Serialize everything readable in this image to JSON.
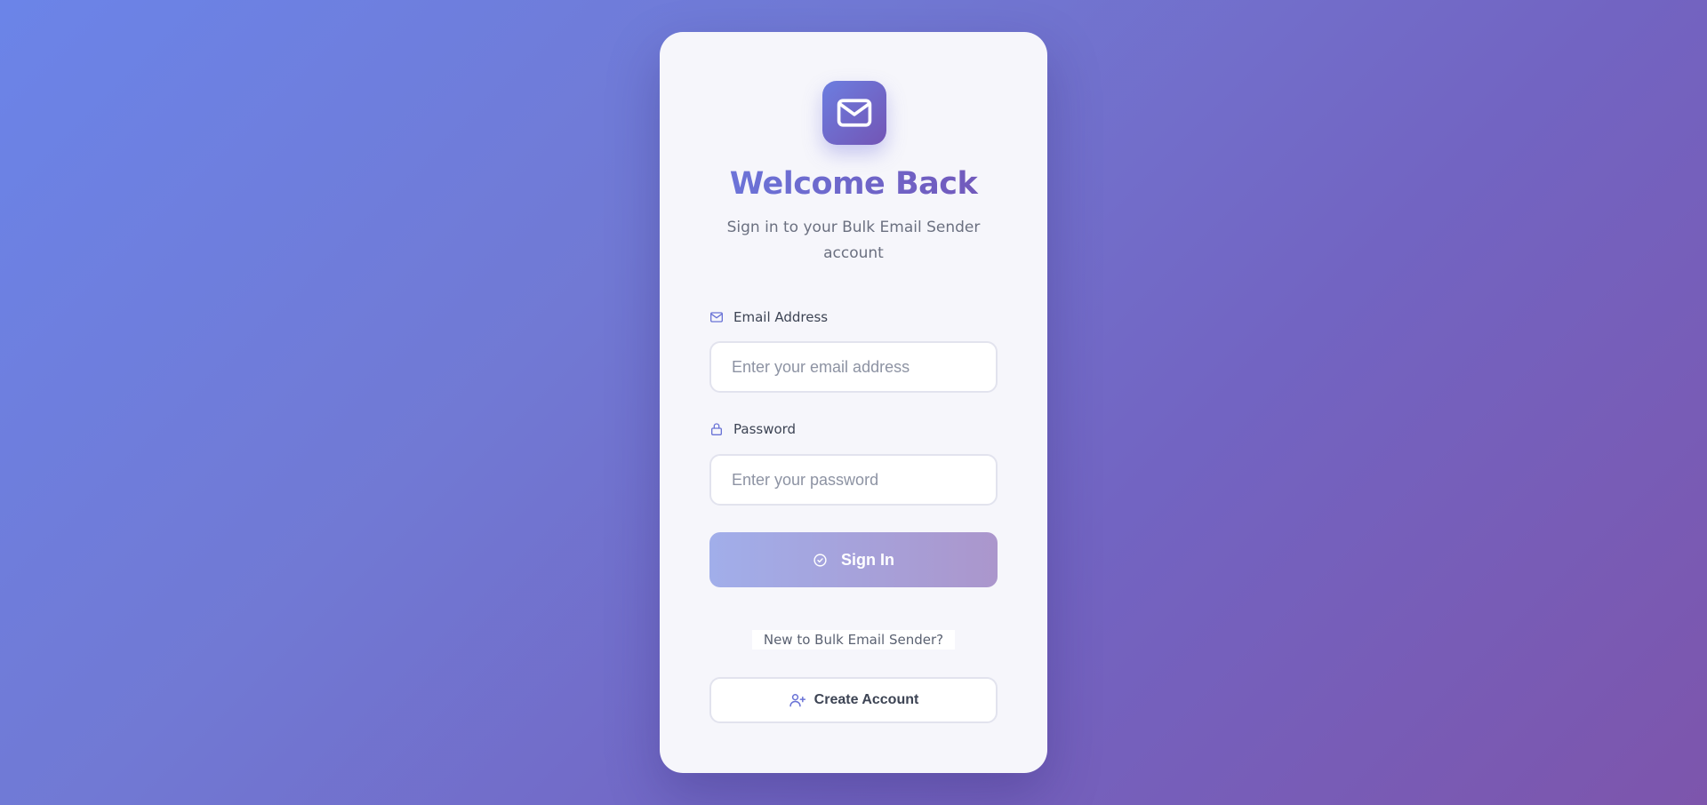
{
  "login": {
    "title": "Welcome Back",
    "subtitle": "Sign in to your Bulk Email Sender account",
    "email": {
      "label": "Email Address",
      "placeholder": "Enter your email address",
      "value": ""
    },
    "password": {
      "label": "Password",
      "placeholder": "Enter your password",
      "value": ""
    },
    "signin_label": "Sign In",
    "register_prompt": "New to Bulk Email Sender?",
    "create_label": "Create Account"
  },
  "icons": {
    "logo": "envelope-icon",
    "email_label": "envelope-icon",
    "password_label": "lock-icon",
    "signin": "check-circle-icon",
    "create": "user-plus-icon"
  },
  "colors": {
    "accent_start": "#6a7be0",
    "accent_end": "#7352b4",
    "card_background": "#f6f6fb"
  }
}
